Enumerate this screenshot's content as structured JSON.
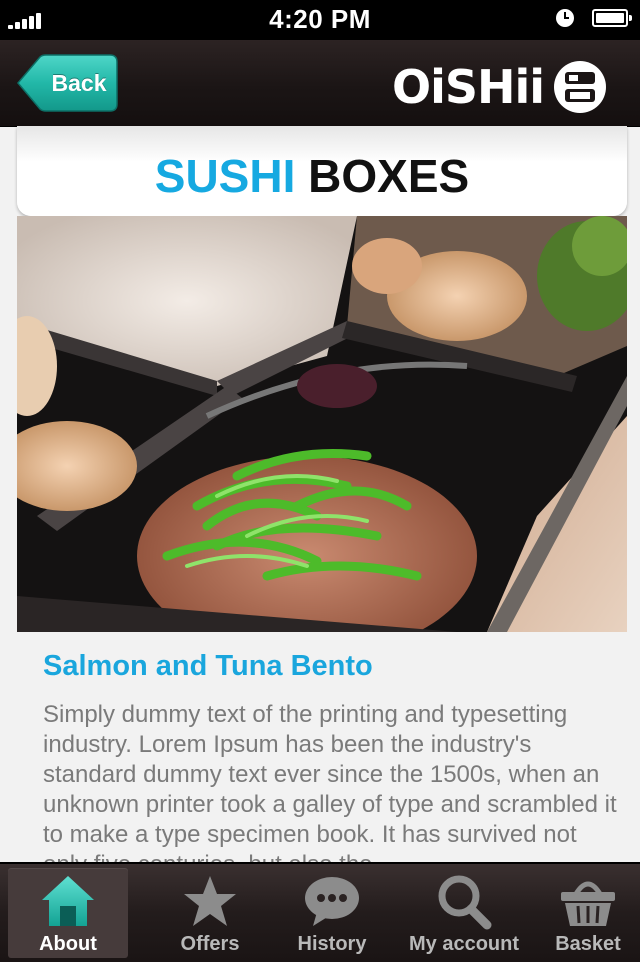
{
  "status_bar": {
    "time": "4:20 PM"
  },
  "nav": {
    "back_label": "Back",
    "brand": "OiSHii"
  },
  "page": {
    "title_part1": "SUSHI",
    "title_part2": "BOXES",
    "item_title": "Salmon and Tuna Bento",
    "item_description": "Simply dummy text of the printing and typesetting industry. Lorem Ipsum has been the industry's standard dummy text ever since the 1500s, when an unknown printer took a galley of type and scrambled it to make a type specimen book. It has survived not only five centuries, but also the"
  },
  "tabs": [
    {
      "label": "About",
      "icon": "home-icon",
      "active": true
    },
    {
      "label": "Offers",
      "icon": "star-icon",
      "active": false
    },
    {
      "label": "History",
      "icon": "chat-bubble-icon",
      "active": false
    },
    {
      "label": "My account",
      "icon": "search-icon",
      "active": false
    },
    {
      "label": "Basket",
      "icon": "basket-icon",
      "active": false
    }
  ],
  "colors": {
    "accent_blue": "#16a9e1",
    "back_button_teal": "#1fb9a8",
    "bar_dark": "#1b1515"
  }
}
